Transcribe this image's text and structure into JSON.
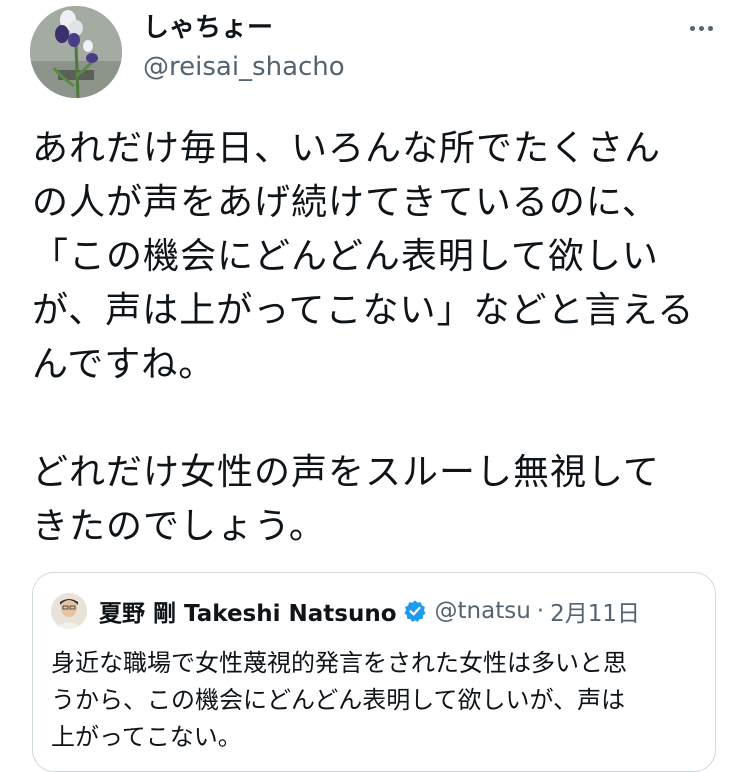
{
  "author": {
    "display_name": "しゃちょー",
    "handle": "@reisai_shacho",
    "avatar_icon": "iris-flower-photo"
  },
  "menu": {
    "more_icon": "more-horizontal-icon"
  },
  "tweet": {
    "text": "あれだけ毎日、いろんな所でたくさん\nの人が声をあげ続けてきているのに、\n「この機会にどんどん表明して欲しい\nが、声は上がってこない」などと言える\nんですね。\n\nどれだけ女性の声をスルーし無視して\nきたのでしょう。"
  },
  "quoted_tweet": {
    "name": "夏野 剛 Takeshi Natsuno",
    "verified_icon": "verified-badge-icon",
    "handle": "@tnatsu",
    "separator": "·",
    "date": "2月11日",
    "text": "身近な職場で女性蔑視的発言をされた女性は多いと思\nうから、この機会にどんどん表明して欲しいが、声は\n上がってこない。"
  },
  "colors": {
    "text_primary": "#0f1419",
    "text_secondary": "#536471",
    "border": "#cfd9de",
    "verified_blue": "#1d9bf0"
  }
}
